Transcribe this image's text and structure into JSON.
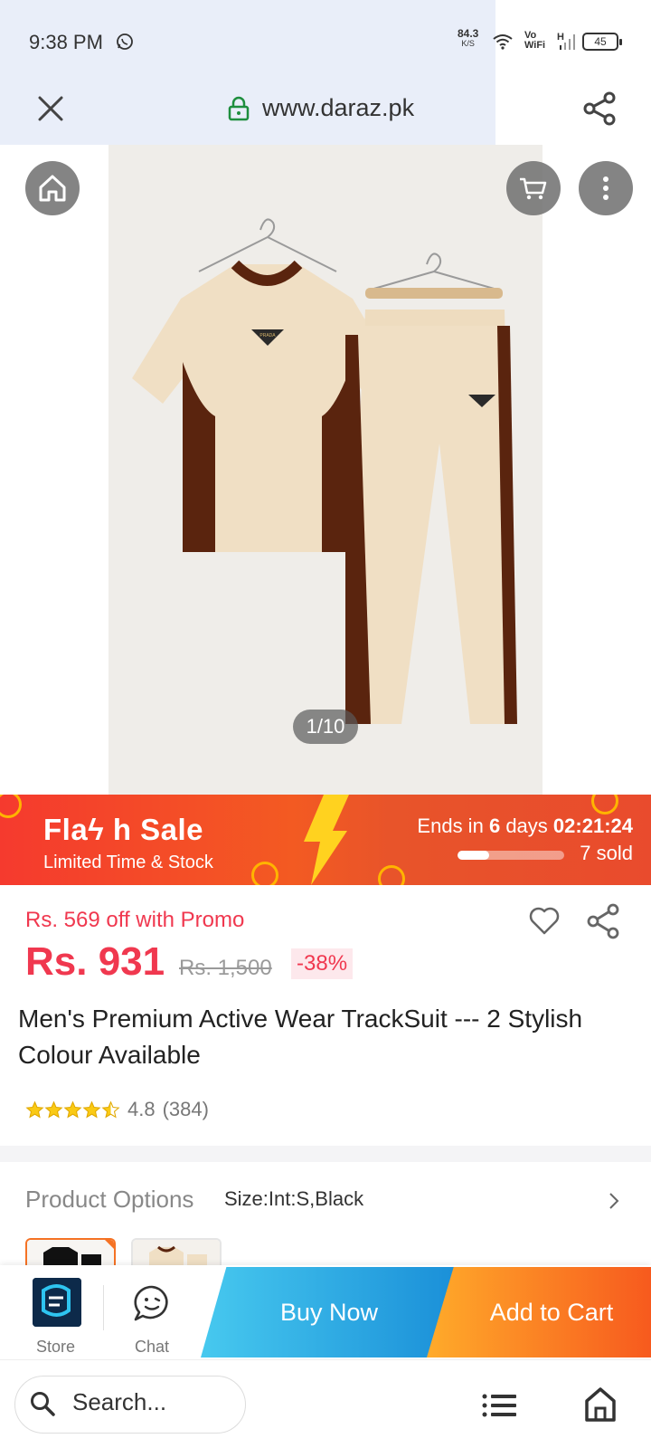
{
  "status_bar": {
    "time": "9:38 PM",
    "speed_value": "84.3",
    "speed_unit": "K/S",
    "vowifi_top": "Vo",
    "vowifi_bottom": "WiFi",
    "network": "H",
    "battery": "45"
  },
  "browser": {
    "url": "www.daraz.pk",
    "search_placeholder": "Search..."
  },
  "gallery": {
    "counter": "1/10",
    "logo_text": "PRADA"
  },
  "flash_sale": {
    "title": "Flaϟ h Sale",
    "subtitle": "Limited Time & Stock",
    "ends_prefix": "Ends in",
    "days_value": "6",
    "days_label": "days",
    "countdown": "02:21:24",
    "sold": "7 sold",
    "progress_fraction": 0.3
  },
  "product": {
    "promo": "Rs. 569 off with Promo",
    "price": "Rs. 931",
    "old_price": "Rs. 1,500",
    "discount": "-38%",
    "title": "Men's Premium Active Wear TrackSuit --- 2 Stylish Colour Available",
    "rating": "4.8",
    "reviews": "(384)",
    "stars": 4.5
  },
  "options": {
    "label": "Product Options",
    "value": "Size:Int:S,Black"
  },
  "actions": {
    "store_label": "Store",
    "chat_label": "Chat",
    "buy_now": "Buy Now",
    "add_to_cart": "Add to Cart"
  },
  "colors": {
    "price_red": "#f0384f",
    "buy_blue": "#1a8fd8",
    "cart_orange": "#f75a1e",
    "flash_red": "#f53a2e",
    "tracksuit_cream": "#f0dfc4",
    "tracksuit_brown": "#5a240e"
  },
  "icons": [
    "whatsapp-icon",
    "wifi-icon",
    "signal-icon",
    "close-icon",
    "lock-icon",
    "share-icon",
    "home-icon",
    "cart-icon",
    "more-icon",
    "heart-icon",
    "star-icon",
    "chevron-right-icon",
    "chat-icon",
    "search-icon",
    "tabs-list-icon"
  ]
}
